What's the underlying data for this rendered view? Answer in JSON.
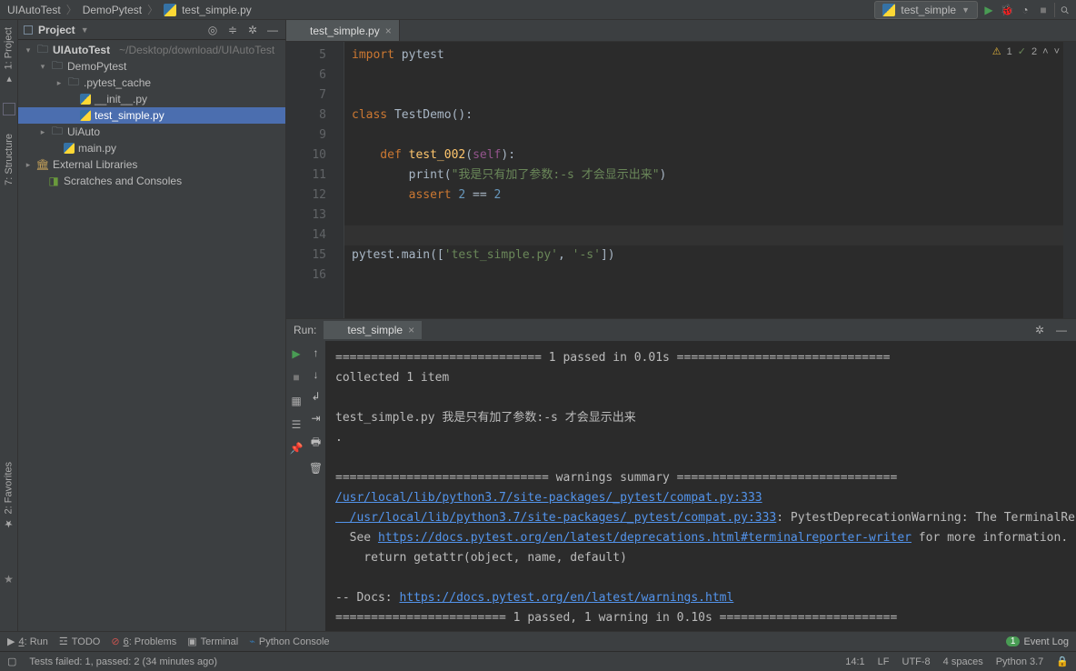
{
  "breadcrumb": {
    "project": "UIAutoTest",
    "folder": "DemoPytest",
    "file": "test_simple.py"
  },
  "toolbar": {
    "run_config": "test_simple"
  },
  "project_panel": {
    "title": "Project",
    "root": "UIAutoTest",
    "root_path": "~/Desktop/download/UIAutoTest",
    "items": [
      {
        "indent": 1,
        "arrow": "▾",
        "icon": "folder",
        "label": "DemoPytest"
      },
      {
        "indent": 2,
        "arrow": "▸",
        "icon": "folder",
        "label": ".pytest_cache"
      },
      {
        "indent": 2,
        "arrow": "",
        "icon": "py",
        "label": "__init__.py"
      },
      {
        "indent": 2,
        "arrow": "",
        "icon": "py",
        "label": "test_simple.py",
        "sel": true
      },
      {
        "indent": 1,
        "arrow": "▸",
        "icon": "folder",
        "label": "UiAuto"
      },
      {
        "indent": 1,
        "arrow": "",
        "icon": "py",
        "label": "main.py"
      }
    ],
    "ext_lib": "External Libraries",
    "scratches": "Scratches and Consoles"
  },
  "editor": {
    "tab": "test_simple.py",
    "inspections": {
      "warn": "1",
      "typo": "2"
    },
    "lines": {
      "l5": "import pytest",
      "l8a": "class",
      "l8b": " TestDemo():",
      "l10a": "    def ",
      "l10b": "test_002",
      "l10c": "(",
      "l10d": "self",
      "l10e": "):",
      "l11a": "        print(",
      "l11b": "\"我是只有加了参数:-s 才会显示出来\"",
      "l11c": ")",
      "l12a": "        assert ",
      "l12b": "2",
      "l12c": " == ",
      "l12d": "2",
      "l15a": "pytest.main([",
      "l15b": "'test_simple.py'",
      "l15c": ", ",
      "l15d": "'-s'",
      "l15e": "])"
    },
    "gutters": [
      "5",
      "6",
      "7",
      "8",
      "9",
      "10",
      "11",
      "12",
      "13",
      "14",
      "15",
      "16"
    ]
  },
  "run": {
    "label": "Run:",
    "tab": "test_simple",
    "lines": {
      "sep1": "============================= 1 passed in 0.01s ==============================",
      "collected": "collected 1 item",
      "out1": "test_simple.py 我是只有加了参数:-s 才会显示出来",
      "dot": ".",
      "warn_head": "============================== warnings summary ===============================",
      "link1": "/usr/local/lib/python3.7/site-packages/_pytest/compat.py:333",
      "link2": "  /usr/local/lib/python3.7/site-packages/_pytest/compat.py:333",
      "warn_msg": ": PytestDeprecationWarning: The TerminalReporter.writer attribute is deprecated, use Te",
      "see": "  See ",
      "see_link": "https://docs.pytest.org/en/latest/deprecations.html#terminalreporter-writer",
      "see2": " for more information.",
      "ret": "    return getattr(object, name, default)",
      "docs": "-- Docs: ",
      "docs_link": "https://docs.pytest.org/en/latest/warnings.html",
      "final": "======================== 1 passed, 1 warning in 0.10s ========================="
    }
  },
  "bottom": {
    "run": "4: Run",
    "todo": "TODO",
    "problems": "6: Problems",
    "terminal": "Terminal",
    "pyconsole": "Python Console",
    "event": "Event Log",
    "badge": "1"
  },
  "status": {
    "tests": "Tests failed: 1, passed: 2 (34 minutes ago)",
    "pos": "14:1",
    "le": "LF",
    "enc": "UTF-8",
    "indent": "4 spaces",
    "interp": "Python 3.7"
  },
  "sidetabs": {
    "project": "1: Project",
    "structure": "7: Structure",
    "fav": "2: Favorites"
  }
}
